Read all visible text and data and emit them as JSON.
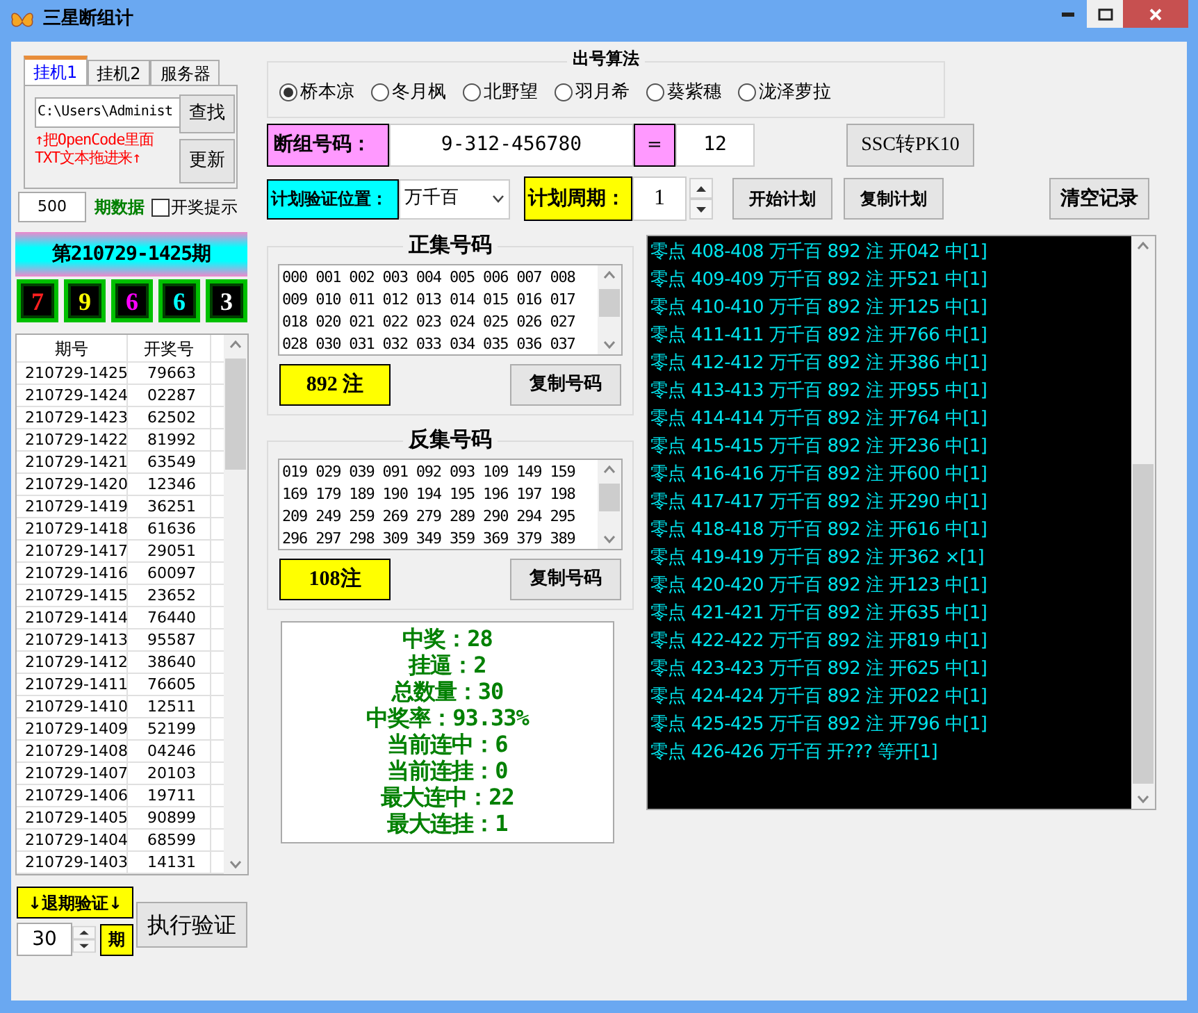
{
  "window": {
    "title": "三星断组计"
  },
  "tabs": [
    {
      "label": "挂机1",
      "selected": true
    },
    {
      "label": "挂机2",
      "selected": false
    },
    {
      "label": "服务器",
      "selected": false
    }
  ],
  "file_path": {
    "value": "C:\\Users\\Administ"
  },
  "find_button": "查找",
  "update_button": "更新",
  "hint_lines": [
    "↑把OpenCode里面",
    "TXT文本拖进来↑"
  ],
  "period_count": {
    "value": "500",
    "label": "期数据"
  },
  "draw_alert": {
    "label": "开奖提示",
    "checked": false
  },
  "current_period": "第210729-1425期",
  "balls": [
    {
      "digit": "7",
      "color": "#ff2020"
    },
    {
      "digit": "9",
      "color": "#ffff00"
    },
    {
      "digit": "6",
      "color": "#ff00ff"
    },
    {
      "digit": "6",
      "color": "#00ffff"
    },
    {
      "digit": "3",
      "color": "#ffffff"
    }
  ],
  "history_table": {
    "columns": [
      "期号",
      "开奖号"
    ],
    "rows": [
      [
        "210729-1425",
        "79663"
      ],
      [
        "210729-1424",
        "02287"
      ],
      [
        "210729-1423",
        "62502"
      ],
      [
        "210729-1422",
        "81992"
      ],
      [
        "210729-1421",
        "63549"
      ],
      [
        "210729-1420",
        "12346"
      ],
      [
        "210729-1419",
        "36251"
      ],
      [
        "210729-1418",
        "61636"
      ],
      [
        "210729-1417",
        "29051"
      ],
      [
        "210729-1416",
        "60097"
      ],
      [
        "210729-1415",
        "23652"
      ],
      [
        "210729-1414",
        "76440"
      ],
      [
        "210729-1413",
        "95587"
      ],
      [
        "210729-1412",
        "38640"
      ],
      [
        "210729-1411",
        "76605"
      ],
      [
        "210729-1410",
        "12511"
      ],
      [
        "210729-1409",
        "52199"
      ],
      [
        "210729-1408",
        "04246"
      ],
      [
        "210729-1407",
        "20103"
      ],
      [
        "210729-1406",
        "19711"
      ],
      [
        "210729-1405",
        "90899"
      ],
      [
        "210729-1404",
        "68599"
      ],
      [
        "210729-1403",
        "14131"
      ]
    ]
  },
  "rollback_button": "↓退期验证↓",
  "rollback_count": {
    "value": "30",
    "unit": "期"
  },
  "run_verify_button": "执行验证",
  "algorithm": {
    "title": "出号算法",
    "options": [
      {
        "label": "桥本凉",
        "selected": true
      },
      {
        "label": "冬月枫",
        "selected": false
      },
      {
        "label": "北野望",
        "selected": false
      },
      {
        "label": "羽月希",
        "selected": false
      },
      {
        "label": "葵紫穗",
        "selected": false
      },
      {
        "label": "泷泽萝拉",
        "selected": false
      }
    ]
  },
  "group_code": {
    "label": "断组号码：",
    "value": "9-312-456780",
    "equals": "=",
    "result": "12"
  },
  "ssc_button": "SSC转PK10",
  "verify_position": {
    "label": "计划验证位置：",
    "value": "万千百"
  },
  "plan_cycle": {
    "label": "计划周期：",
    "value": "1"
  },
  "plan_buttons": [
    "开始计划",
    "复制计划"
  ],
  "clear_button": "清空记录",
  "positive_set": {
    "title": "正集号码",
    "numbers": [
      "000 001 002 003 004 005 006 007 008",
      "009 010 011 012 013 014 015 016 017",
      "018 020 021 022 023 024 025 026 027",
      "028 030 031 032 033 034 035 036 037"
    ],
    "count": "892 注",
    "copy_button": "复制号码"
  },
  "negative_set": {
    "title": "反集号码",
    "numbers": [
      "019 029 039 091 092 093 109 149 159",
      "169 179 189 190 194 195 196 197 198",
      "209 249 259 269 279 289 290 294 295",
      "296 297 298 309 349 359 369 379 389"
    ],
    "count": "108注",
    "copy_button": "复制号码"
  },
  "stats": [
    "中奖：28",
    "挂逼：2",
    "总数量：30",
    "中奖率：93.33%",
    "当前连中：6",
    "当前连挂：0",
    "最大连中：22",
    "最大连挂：1"
  ],
  "log": [
    "零点 408-408 万千百 892 注 开042 中[1]",
    "零点 409-409 万千百 892 注 开521 中[1]",
    "零点 410-410 万千百 892 注 开125 中[1]",
    "零点 411-411 万千百 892 注 开766 中[1]",
    "零点 412-412 万千百 892 注 开386 中[1]",
    "零点 413-413 万千百 892 注 开955 中[1]",
    "零点 414-414 万千百 892 注 开764 中[1]",
    "零点 415-415 万千百 892 注 开236 中[1]",
    "零点 416-416 万千百 892 注 开600 中[1]",
    "零点 417-417 万千百 892 注 开290 中[1]",
    "零点 418-418 万千百 892 注 开616 中[1]",
    "零点 419-419 万千百 892 注 开362 ×[1]",
    "零点 420-420 万千百 892 注 开123 中[1]",
    "零点 421-421 万千百 892 注 开635 中[1]",
    "零点 422-422 万千百 892 注 开819 中[1]",
    "零点 423-423 万千百 892 注 开625 中[1]",
    "零点 424-424 万千百 892 注 开022 中[1]",
    "零点 425-425 万千百 892 注 开796 中[1]",
    "零点 426-426 万千百 开???  等开[1]"
  ]
}
